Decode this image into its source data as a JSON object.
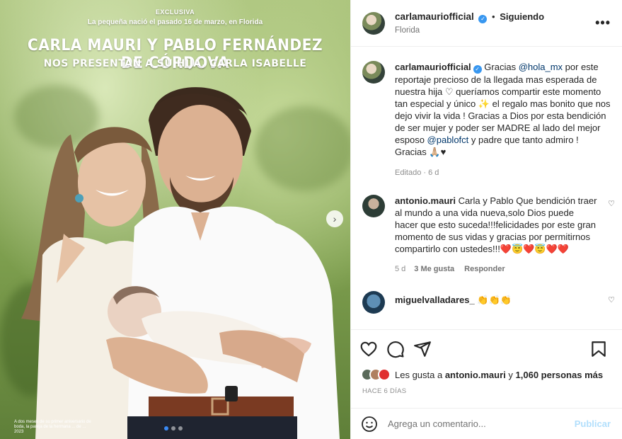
{
  "photo": {
    "excl": "EXCLUSIVA",
    "subtitle": "La pequeña nació el pasado 16 de marzo, en Florida",
    "title": "CARLA MAURI Y PABLO FERNÁNDEZ DE CÓRDOVA",
    "title2": "NOS PRESENTAN A SU HIJA, CARLA ISABELLE",
    "caption": "A dos meses de su primer aniversario de boda, la pareja de la hermana ... de ... 2023",
    "next_symbol": "›",
    "slide_active": 1,
    "slide_count": 3
  },
  "header": {
    "username": "carlamauriofficial",
    "dot": "•",
    "follow": "Siguiendo",
    "location": "Florida",
    "more": "•••"
  },
  "caption": {
    "username": "carlamauriofficial",
    "t1": "Gracias ",
    "m1": "@hola_mx",
    "t2": " por este reportaje precioso de la llegada mas esperada de nuestra hija ♡ queríamos compartir este momento tan especial y único ✨ el regalo mas bonito que nos dejo vivir la vida ! Gracias a Dios por esta bendición de ser mujer y poder ser MADRE al lado del mejor esposo ",
    "m2": "@pablofct",
    "t3": " y padre que tanto admiro ! Gracias 🙏🏼♥",
    "meta": "Editado · 6 d"
  },
  "comment1": {
    "username": "antonio.mauri",
    "text": " Carla y Pablo Que bendición traer al mundo a una vida nueva,solo Dios puede hacer que esto suceda!!!felicidades por este gran momento de sus vidas y gracias por permitirnos compartirlo con ustedes!!!❤️😇❤️😇❤️❤️",
    "time": "5 d",
    "likes": "3 Me gusta",
    "reply": "Responder"
  },
  "comment2": {
    "username": "miguelvalladares_",
    "text": " 👏👏👏"
  },
  "likes": {
    "prefix": "Les gusta a ",
    "user": "antonio.mauri",
    "mid": " y ",
    "count": "1,060 personas más"
  },
  "posted": "HACE 6 DÍAS",
  "add_comment": {
    "placeholder": "Agrega un comentario...",
    "publish": "Publicar"
  },
  "colors": {
    "link": "#00376b",
    "verified": "#3897f0",
    "publish": "#b2dffc",
    "meta": "#8e8e8e"
  }
}
